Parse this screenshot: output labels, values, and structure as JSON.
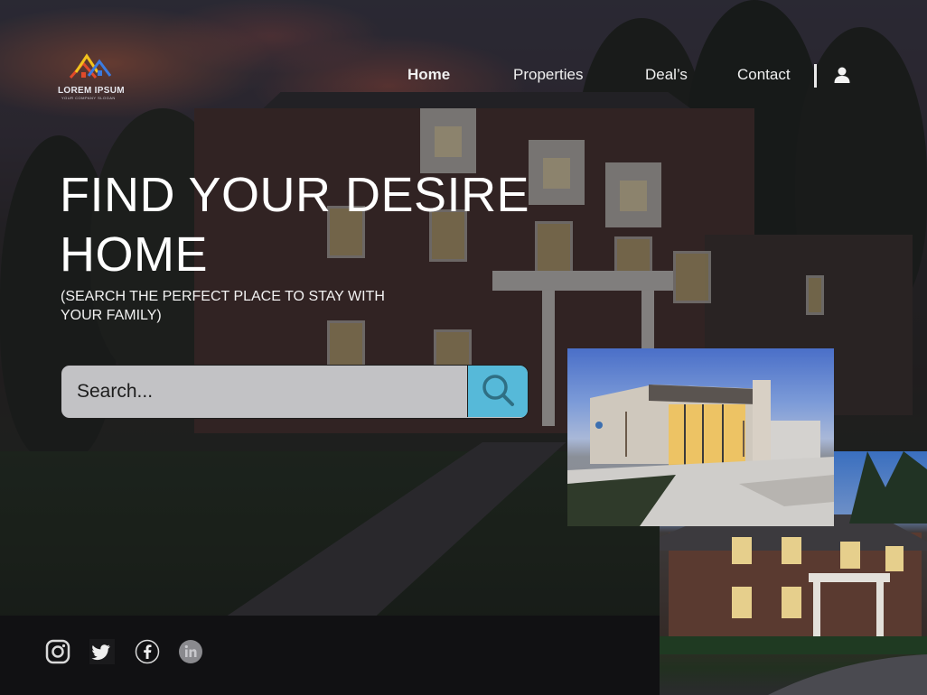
{
  "header": {
    "logo_text": "LOREM IPSUM",
    "logo_tagline": "YOUR COMPANY SLOGAN",
    "nav": [
      {
        "label": "Home",
        "active": true
      },
      {
        "label": "Properties",
        "active": false
      },
      {
        "label": "Deal’s",
        "active": false
      },
      {
        "label": "Contact",
        "active": false
      }
    ],
    "user_icon": "user-icon"
  },
  "hero": {
    "title": "FIND YOUR DESIRE HOME",
    "subtitle": "(SEARCH THE PERFECT PLACE TO STAY WITH YOUR FAMILY)"
  },
  "search": {
    "placeholder": "Search...",
    "button_icon": "search-icon"
  },
  "footer": {
    "social": [
      "instagram-icon",
      "twitter-icon",
      "facebook-icon",
      "linkedin-icon"
    ]
  },
  "colors": {
    "accent": "#56b9d9",
    "footer_bg": "#111113",
    "text": "#ffffff"
  }
}
